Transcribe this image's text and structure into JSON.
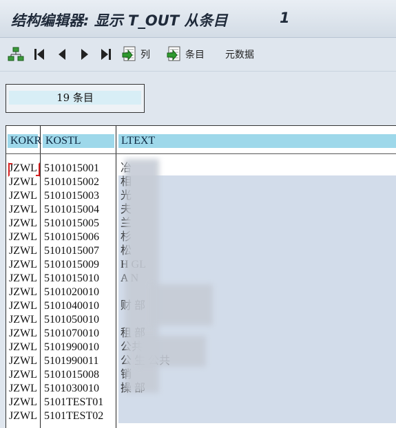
{
  "window": {
    "title": "结构编辑器: 显示 T_OUT 从条目",
    "title_number": "1"
  },
  "toolbar": {
    "hierarchy_icon": "hierarchy-icon",
    "first_icon": "first-page-icon",
    "prev_icon": "previous-icon",
    "next_icon": "next-icon",
    "last_icon": "last-page-icon",
    "columns_label": "列",
    "entries_label": "条目",
    "metadata_label": "元数据"
  },
  "summary": {
    "entry_count_text": "19 条目"
  },
  "table": {
    "headers": [
      "KOKR",
      "KOSTL",
      "LTEXT"
    ],
    "rows": [
      {
        "kokr": "JZWL",
        "kostl": "5101015001",
        "ltext": "      冶"
      },
      {
        "kokr": "JZWL",
        "kostl": "5101015002",
        "ltext": "相"
      },
      {
        "kokr": "JZWL",
        "kostl": "5101015003",
        "ltext": "光"
      },
      {
        "kokr": "JZWL",
        "kostl": "5101015004",
        "ltext": "夫"
      },
      {
        "kokr": "JZWL",
        "kostl": "5101015005",
        "ltext": "兰"
      },
      {
        "kokr": "JZWL",
        "kostl": "5101015006",
        "ltext": "杉"
      },
      {
        "kokr": "JZWL",
        "kostl": "5101015007",
        "ltext": "松"
      },
      {
        "kokr": "JZWL",
        "kostl": "5101015009",
        "ltext": "H    GL"
      },
      {
        "kokr": "JZWL",
        "kostl": "5101015010",
        "ltext": "A    N"
      },
      {
        "kokr": "JZWL",
        "kostl": "5101020010",
        "ltext": ""
      },
      {
        "kokr": "JZWL",
        "kostl": "5101040010",
        "ltext": "财    部"
      },
      {
        "kokr": "JZWL",
        "kostl": "5101050010",
        "ltext": ""
      },
      {
        "kokr": "JZWL",
        "kostl": "5101070010",
        "ltext": "租    部"
      },
      {
        "kokr": "JZWL",
        "kostl": "5101990010",
        "ltext": "        公共"
      },
      {
        "kokr": "JZWL",
        "kostl": "5101990011",
        "ltext": "公    生    公共"
      },
      {
        "kokr": "JZWL",
        "kostl": "5101015008",
        "ltext": "销"
      },
      {
        "kokr": "JZWL",
        "kostl": "5101030010",
        "ltext": "操    部"
      },
      {
        "kokr": "JZWL",
        "kostl": "5101TEST01",
        "ltext": ""
      },
      {
        "kokr": "JZWL",
        "kostl": "5101TEST02",
        "ltext": ""
      }
    ]
  },
  "colors": {
    "header_bg": "#9ed8ea",
    "ltext_bg": "#d2dcea",
    "cursor": "#d62020"
  }
}
